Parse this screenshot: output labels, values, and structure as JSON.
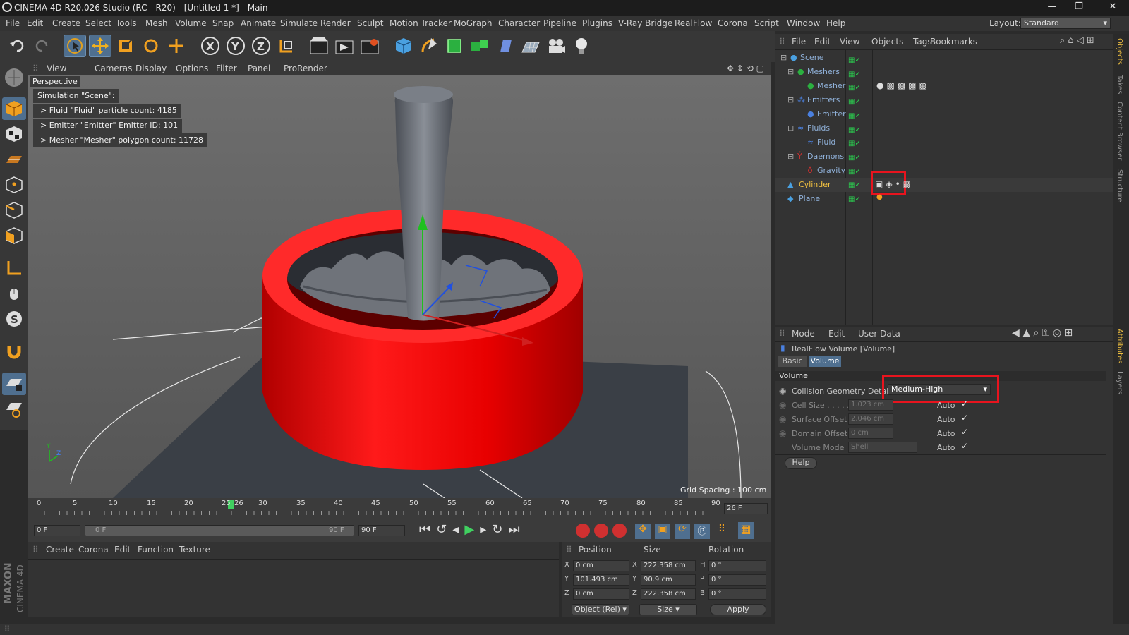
{
  "window": {
    "title": "CINEMA 4D R20.026 Studio (RC - R20) - [Untitled 1 *] - Main"
  },
  "menubar": {
    "items": [
      "File",
      "Edit",
      "Create",
      "Select",
      "Tools",
      "Mesh",
      "Volume",
      "Snap",
      "Animate",
      "Simulate",
      "Render",
      "Sculpt",
      "Motion Tracker",
      "MoGraph",
      "Character",
      "Pipeline",
      "Plugins",
      "V-Ray Bridge",
      "RealFlow",
      "Corona",
      "Script",
      "Window",
      "Help"
    ],
    "layout_label": "Layout:",
    "layout_value": "Standard"
  },
  "viewport": {
    "menu": [
      "View",
      "Cameras",
      "Display",
      "Options",
      "Filter",
      "Panel",
      "ProRender"
    ],
    "camera_label": "Perspective",
    "hud": [
      "Simulation \"Scene\":",
      "> Fluid \"Fluid\" particle count: 4185",
      "> Emitter \"Emitter\" Emitter ID: 101",
      "> Mesher \"Mesher\" polygon count: 11728"
    ],
    "grid_spacing": "Grid Spacing : 100 cm",
    "axis_y": "Y",
    "axis_z": "Z"
  },
  "timeline": {
    "ticks": [
      "0",
      "5",
      "10",
      "15",
      "20",
      "25",
      "26",
      "30",
      "35",
      "40",
      "45",
      "50",
      "55",
      "60",
      "65",
      "70",
      "75",
      "80",
      "85",
      "90"
    ],
    "current_frame": "26 F",
    "start_frame": "0 F",
    "range_start": "0 F",
    "range_end": "90 F",
    "end_frame": "90 F"
  },
  "materials": {
    "menu": [
      "Create",
      "Corona",
      "Edit",
      "Function",
      "Texture"
    ]
  },
  "coords": {
    "headers": [
      "Position",
      "Size",
      "Rotation"
    ],
    "rows": [
      {
        "axis": "X",
        "pos": "0 cm",
        "saxis": "X",
        "size": "222.358 cm",
        "raxis": "H",
        "rot": "0 °"
      },
      {
        "axis": "Y",
        "pos": "101.493 cm",
        "saxis": "Y",
        "size": "90.9 cm",
        "raxis": "P",
        "rot": "0 °"
      },
      {
        "axis": "Z",
        "pos": "0 cm",
        "saxis": "Z",
        "size": "222.358 cm",
        "raxis": "B",
        "rot": "0 °"
      }
    ],
    "mode": "Object (Rel)",
    "size_mode": "Size",
    "apply": "Apply"
  },
  "objects": {
    "menu": [
      "File",
      "Edit",
      "View",
      "Objects",
      "Tags",
      "Bookmarks"
    ],
    "tree": [
      "Scene",
      "Meshers",
      "Mesher",
      "Emitters",
      "Emitter",
      "Fluids",
      "Fluid",
      "Daemons",
      "Gravity",
      "Cylinder",
      "Plane"
    ]
  },
  "attributes": {
    "menu": [
      "Mode",
      "Edit",
      "User Data"
    ],
    "title": "RealFlow Volume [Volume]",
    "tabs": [
      "Basic",
      "Volume"
    ],
    "section": "Volume",
    "collision_label": "Collision Geometry Detai",
    "collision_value": "Medium-High",
    "cell_size_label": "Cell Size . . . . .",
    "cell_size": "1.023 cm",
    "surface_offset_label": "Surface Offset",
    "surface_offset": "2.046 cm",
    "domain_offset_label": "Domain Offset",
    "domain_offset": "0 cm",
    "volume_mode_label": "Volume Mode",
    "volume_mode": "Shell",
    "auto": "Auto",
    "help": "Help"
  },
  "right_tabs": [
    "Objects",
    "Takes",
    "Content Browser",
    "Structure",
    "Attributes",
    "Layers"
  ],
  "brand": {
    "maxon": "MAXON",
    "product": "CINEMA 4D"
  },
  "colors": {
    "accent_red": "#e00000",
    "highlight_box": "#e8141e",
    "selected_object": "#f0c040"
  }
}
